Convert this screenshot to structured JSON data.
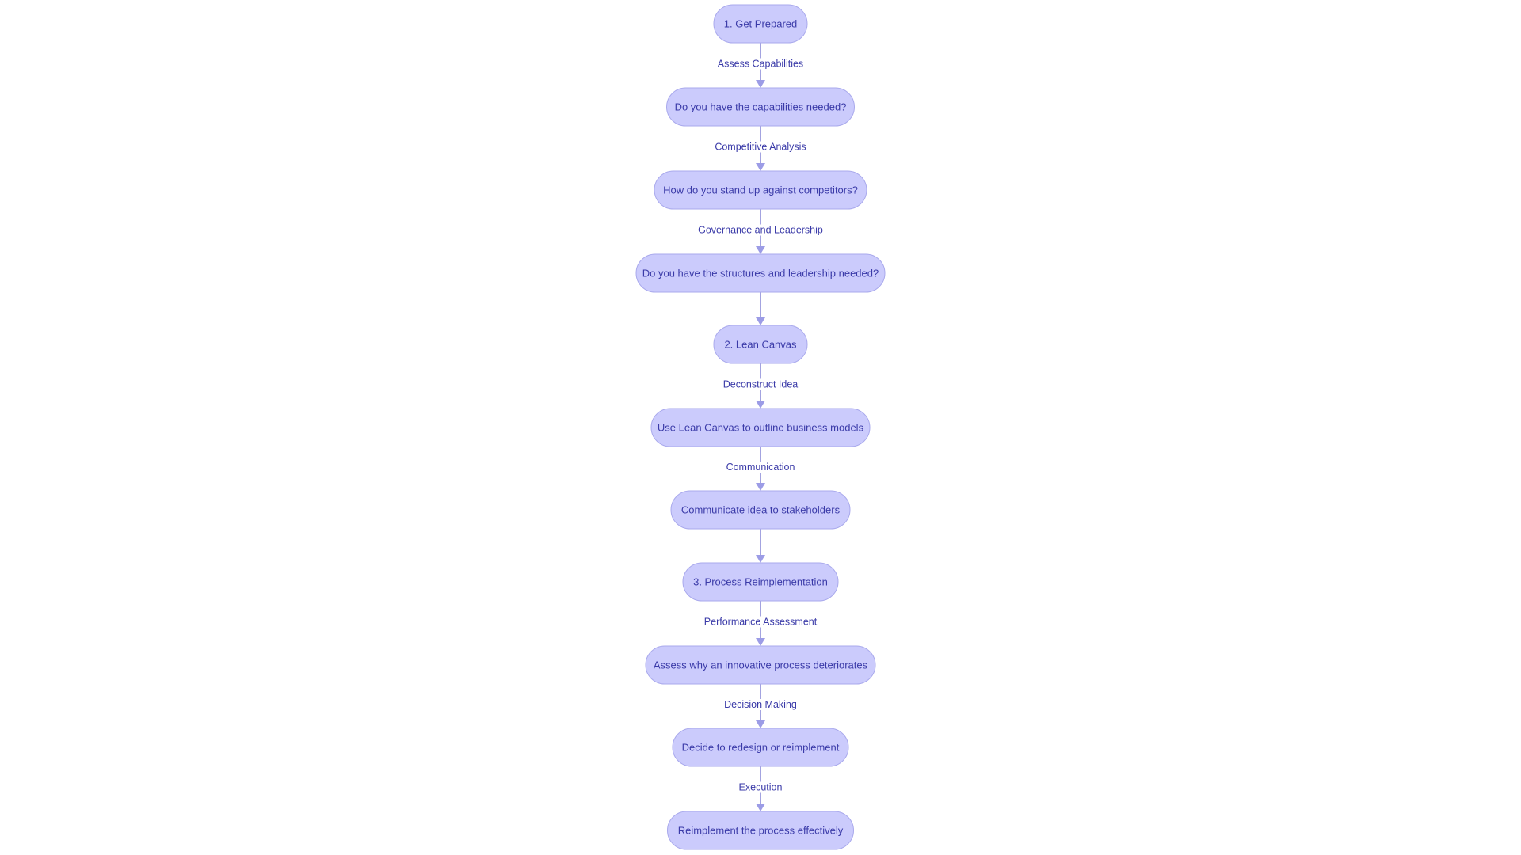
{
  "diagram": {
    "type": "flowchart",
    "direction": "top-to-bottom",
    "colors": {
      "node_fill": "#cbcbfc",
      "node_border": "#a9a9ec",
      "text": "#3a3aa8",
      "edge": "#a3a3e0",
      "background": "#ffffff"
    },
    "nodes": [
      {
        "id": "n1",
        "label": "1. Get Prepared"
      },
      {
        "id": "n2",
        "label": "Do you have the capabilities needed?"
      },
      {
        "id": "n3",
        "label": "How do you stand up against competitors?"
      },
      {
        "id": "n4",
        "label": "Do you have the structures and leadership needed?"
      },
      {
        "id": "n5",
        "label": "2. Lean Canvas"
      },
      {
        "id": "n6",
        "label": "Use Lean Canvas to outline business models"
      },
      {
        "id": "n7",
        "label": "Communicate idea to stakeholders"
      },
      {
        "id": "n8",
        "label": "3. Process Reimplementation"
      },
      {
        "id": "n9",
        "label": "Assess why an innovative process deteriorates"
      },
      {
        "id": "n10",
        "label": "Decide to redesign or reimplement"
      },
      {
        "id": "n11",
        "label": "Reimplement the process effectively"
      }
    ],
    "edges": [
      {
        "from": "n1",
        "to": "n2",
        "label": "Assess Capabilities"
      },
      {
        "from": "n2",
        "to": "n3",
        "label": "Competitive Analysis"
      },
      {
        "from": "n3",
        "to": "n4",
        "label": "Governance and Leadership"
      },
      {
        "from": "n4",
        "to": "n5",
        "label": ""
      },
      {
        "from": "n5",
        "to": "n6",
        "label": "Deconstruct Idea"
      },
      {
        "from": "n6",
        "to": "n7",
        "label": "Communication"
      },
      {
        "from": "n7",
        "to": "n8",
        "label": ""
      },
      {
        "from": "n8",
        "to": "n9",
        "label": "Performance Assessment"
      },
      {
        "from": "n9",
        "to": "n10",
        "label": "Decision Making"
      },
      {
        "from": "n10",
        "to": "n11",
        "label": "Execution"
      }
    ]
  }
}
